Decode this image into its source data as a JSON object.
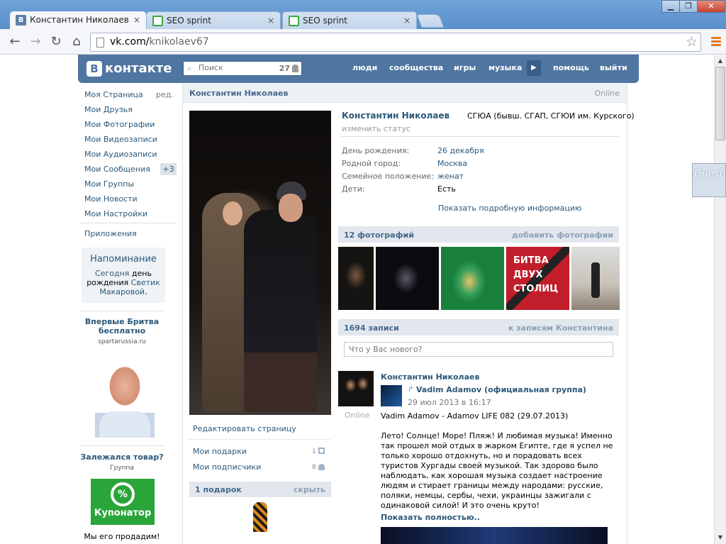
{
  "browser": {
    "tabs": [
      {
        "label": "Константин Николаев",
        "active": true
      },
      {
        "label": "SEO sprint",
        "active": false
      },
      {
        "label": "SEO sprint",
        "active": false
      }
    ],
    "url_host": "vk.com/",
    "url_path": "knikolaev67",
    "window_buttons": {
      "minimize": "▁",
      "maximize": "❐",
      "close": "✕"
    }
  },
  "header": {
    "logo_text": "контакте",
    "logo_letter": "В",
    "search_placeholder": "Поиск",
    "search_count": "27",
    "nav": [
      "люди",
      "сообщества",
      "игры",
      "музыка",
      "помощь",
      "выйти"
    ],
    "brand_color": "#4f76a0"
  },
  "left_menu": {
    "items": [
      "Моя Страница",
      "Мои Друзья",
      "Мои Фотографии",
      "Мои Видеозаписи",
      "Мои Аудиозаписи",
      "Мои Сообщения",
      "Мои Группы",
      "Мои Новости",
      "Мои Настройки"
    ],
    "edit_label": "ред.",
    "messages_badge": "+3",
    "apps_label": "Приложения"
  },
  "reminder": {
    "title": "Напоминание",
    "today": "Сегодня",
    "text_a": " день рождения ",
    "name": "Светик Макаровой",
    "dot": "."
  },
  "ads": {
    "ad1_title": "Впервые Бритва бесплатно",
    "ad1_domain": "spartarussia.ru",
    "ad2_title": "Залежался товар?",
    "ad2_sub": "Группа",
    "ad2_brand": "Купонатор",
    "ad2_footer": "Мы его продадим!"
  },
  "profile": {
    "bar_name": "Константин Николаев",
    "online": "Online",
    "name": "Константин Николаев",
    "school": "СГЮА (бывш. СГАП, СГЮИ им. Курского)",
    "status_link": "изменить статус",
    "info": [
      {
        "label": "День рождения:",
        "value": "26 декабря"
      },
      {
        "label": "Родной город:",
        "value": "Москва"
      },
      {
        "label": "Семейное положение:",
        "value": "женат"
      },
      {
        "label": "Дети:",
        "value": "Есть"
      }
    ],
    "more_info": "Показать подробную информацию",
    "edit_page": "Редактировать страницу",
    "gifts_link": "Мои подарки",
    "gifts_count": "1",
    "subs_link": "Мои подписчики",
    "subs_count": "8",
    "gifts_bar_title": "1 подарок",
    "gifts_bar_hide": "скрыть"
  },
  "photos": {
    "title": "12 фотографий",
    "add": "добавить фотографии",
    "photo4_text": "БИТВА ДВУХ СТОЛИЦ"
  },
  "wall": {
    "title": "1694 записи",
    "link": "к записям Константина",
    "input_placeholder": "Что у Вас нового?",
    "post": {
      "author": "Константин Николаев",
      "online": "Online",
      "group": "Vadim Adamov (официальная группа)",
      "date": "29 июл 2013 в 16:17",
      "line1": "Vadim Adamov - Adamov LIFE 082 (29.07.2013)",
      "body": "Лето! Солнце! Море! Пляж! И любимая музыка! Именно так прошел мой отдых в жарком Египте, где я успел не только хорошо отдохнуть, но и порадовать всех туристов Хургады своей музыкой. Так здорово было наблюдать, как хорошая музыка создает настроение людям и стирает границы между народами: русские, поляки, немцы, сербы, чехи, украинцы зажигали с одинаковой силой! И это очень круто!",
      "more": "Показать полностью.."
    }
  },
  "overlay": {
    "guest": "Guest"
  }
}
